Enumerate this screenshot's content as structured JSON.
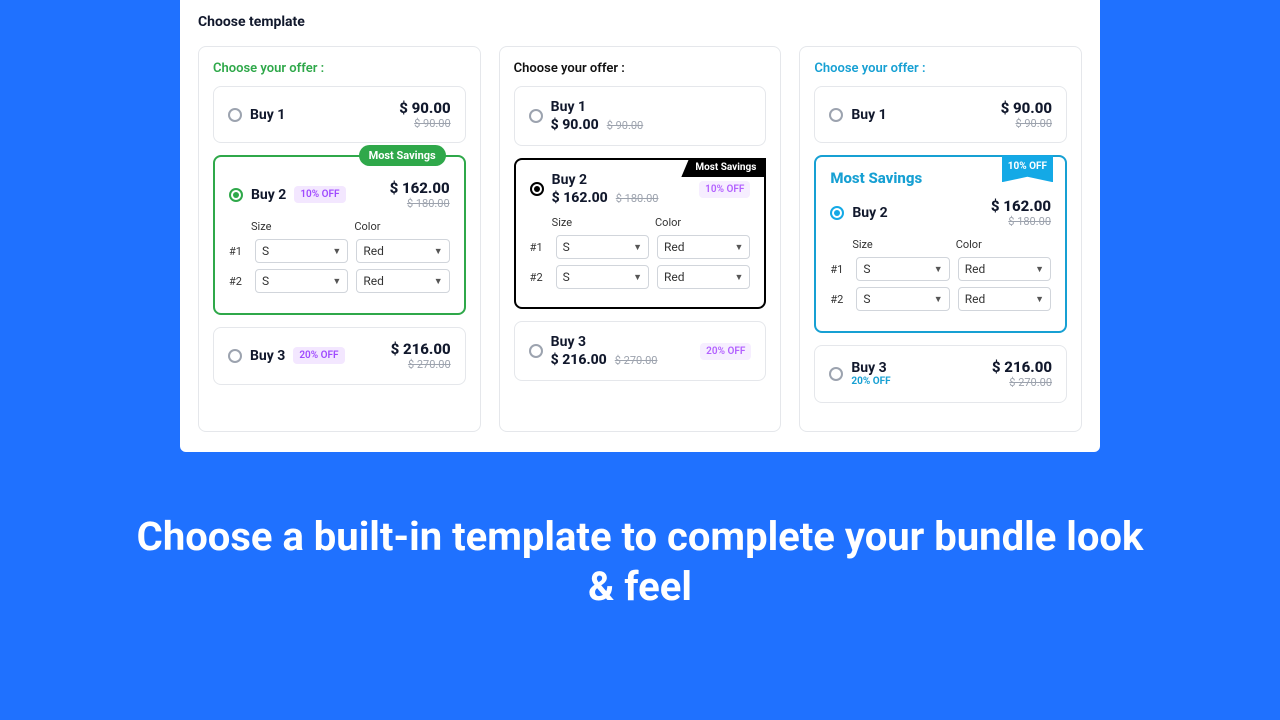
{
  "panel": {
    "title": "Choose template"
  },
  "common": {
    "choose_label": "Choose your offer :",
    "size_label": "Size",
    "color_label": "Color",
    "size_value": "S",
    "color_value": "Red",
    "row1": "#1",
    "row2": "#2",
    "most_savings": "Most Savings"
  },
  "offers": {
    "buy1": {
      "title": "Buy 1",
      "price": "$ 90.00",
      "compare": "$ 90.00"
    },
    "buy2": {
      "title": "Buy 2",
      "price": "$ 162.00",
      "compare": "$ 180.00",
      "discount": "10% OFF"
    },
    "buy3": {
      "title": "Buy 3",
      "price": "$ 216.00",
      "compare": "$ 270.00",
      "discount": "20% OFF"
    }
  },
  "hero": "Choose a built-in template to complete your bundle look & feel"
}
